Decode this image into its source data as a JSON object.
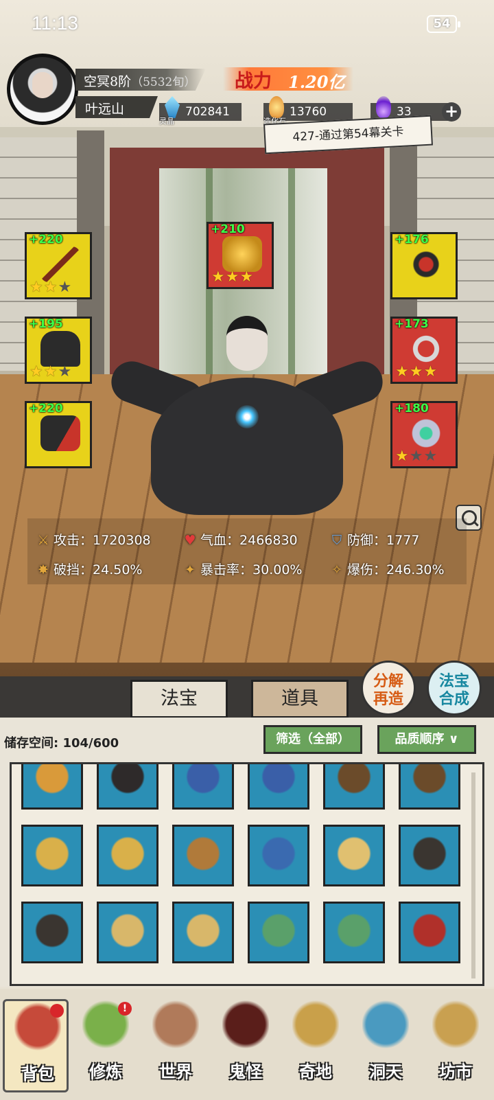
{
  "status_bar": {
    "time": "11:13",
    "battery": "54"
  },
  "player": {
    "realm": "空冥8阶",
    "realm_detail": "（5532旬）",
    "name": "叶远山",
    "power_label": "战力",
    "power_value": "1.20亿"
  },
  "resources": [
    {
      "name": "灵晶",
      "value": "702841",
      "icon": "blue-crystal-icon"
    },
    {
      "name": "造化石",
      "value": "13760",
      "icon": "orange-stone-icon"
    },
    {
      "name": "",
      "value": "33",
      "icon": "purple-flame-icon"
    }
  ],
  "stage_tag": "427-通过第54幕关卡",
  "equipment": [
    {
      "slot": "weapon",
      "bonus": "+220",
      "stars": 2,
      "max_stars": 3,
      "color": "#e8d21a",
      "icon": "sword-icon"
    },
    {
      "slot": "talisman",
      "bonus": "+210",
      "stars": 3,
      "max_stars": 3,
      "color": "#cf3b33",
      "icon": "golden-dragon-icon"
    },
    {
      "slot": "ring-top",
      "bonus": "+176",
      "stars": 0,
      "max_stars": 0,
      "color": "#e8d21a",
      "icon": "ruby-ring-icon"
    },
    {
      "slot": "robe",
      "bonus": "+195",
      "stars": 2,
      "max_stars": 3,
      "color": "#e8d21a",
      "icon": "robe-icon"
    },
    {
      "slot": "necklace",
      "bonus": "+173",
      "stars": 3,
      "max_stars": 3,
      "color": "#cf3b33",
      "icon": "pendant-icon"
    },
    {
      "slot": "boots",
      "bonus": "+220",
      "stars": 0,
      "max_stars": 0,
      "color": "#e8d21a",
      "icon": "boots-icon"
    },
    {
      "slot": "bracelet",
      "bonus": "+180",
      "stars": 1,
      "max_stars": 3,
      "color": "#cf3b33",
      "icon": "jade-ring-icon"
    }
  ],
  "stats": [
    {
      "label": "攻击：",
      "value": "1720308",
      "icon": "sword-small-icon",
      "color": "#e2a63b"
    },
    {
      "label": "气血：",
      "value": "2466830",
      "icon": "heart-icon",
      "color": "#e23b3b"
    },
    {
      "label": "防御：",
      "value": "1777",
      "icon": "shield-icon",
      "color": "#6aa0d8"
    },
    {
      "label": "破挡：",
      "value": "24.50%",
      "icon": "break-icon",
      "color": "#e2a63b"
    },
    {
      "label": "暴击率：",
      "value": "30.00%",
      "icon": "crit-icon",
      "color": "#e2a63b"
    },
    {
      "label": "爆伤：",
      "value": "246.30%",
      "icon": "crit-damage-icon",
      "color": "#e2a63b"
    }
  ],
  "tabs": [
    {
      "label": "法宝",
      "active": true
    },
    {
      "label": "道具",
      "active": false
    }
  ],
  "side_buttons": {
    "decompose_line1": "分解",
    "decompose_line2": "再造",
    "fuse_line1": "法宝",
    "fuse_line2": "合成"
  },
  "storage": {
    "label": "储存空间:",
    "value": "104/600",
    "filter": "筛选（全部）",
    "sort": "品质顺序",
    "sort_icon": "chevron-down-icon"
  },
  "inventory": [
    {
      "icon": "golden-beast-icon",
      "color": "#d99a3a"
    },
    {
      "icon": "dark-robe-icon",
      "color": "#2e2a2a"
    },
    {
      "icon": "fish-armor-icon",
      "color": "#3a5fa8"
    },
    {
      "icon": "fish-armor-icon",
      "color": "#3a5fa8"
    },
    {
      "icon": "brown-robe-icon",
      "color": "#6b4b2a"
    },
    {
      "icon": "brown-robe-icon",
      "color": "#6b4b2a"
    },
    {
      "icon": "gold-armor-icon",
      "color": "#d9b04a"
    },
    {
      "icon": "gold-armor-icon",
      "color": "#d9b04a"
    },
    {
      "icon": "bracer-icon",
      "color": "#b07a3a"
    },
    {
      "icon": "fish-boot-icon",
      "color": "#3a6ab0"
    },
    {
      "icon": "feather-token-icon",
      "color": "#e0c070"
    },
    {
      "icon": "dark-boot-icon",
      "color": "#3a3530"
    },
    {
      "icon": "dark-boot-icon",
      "color": "#3a3530"
    },
    {
      "icon": "crown-icon",
      "color": "#d8b76a"
    },
    {
      "icon": "crown-icon",
      "color": "#d8b76a"
    },
    {
      "icon": "leaf-wreath-icon",
      "color": "#5aa06a"
    },
    {
      "icon": "leaf-wreath-icon",
      "color": "#5aa06a"
    },
    {
      "icon": "ruby-ring-icon",
      "color": "#b0302a"
    }
  ],
  "nav": [
    {
      "label": "背包",
      "icon": "bag-icon",
      "color": "#c64a3a",
      "active": true,
      "badge": ""
    },
    {
      "label": "修炼",
      "icon": "lotus-icon",
      "color": "#7ab04a",
      "active": false,
      "badge": "!"
    },
    {
      "label": "世界",
      "icon": "scroll-map-icon",
      "color": "#b07a5a",
      "active": false,
      "badge": ""
    },
    {
      "label": "鬼怪",
      "icon": "demon-egg-icon",
      "color": "#5a1e1a",
      "active": false,
      "badge": ""
    },
    {
      "label": "奇地",
      "icon": "pagoda-icon",
      "color": "#c9a04a",
      "active": false,
      "badge": ""
    },
    {
      "label": "洞天",
      "icon": "portal-icon",
      "color": "#4a9ac0",
      "active": false,
      "badge": ""
    },
    {
      "label": "坊市",
      "icon": "market-stall-icon",
      "color": "#c9a050",
      "active": false,
      "badge": ""
    }
  ]
}
